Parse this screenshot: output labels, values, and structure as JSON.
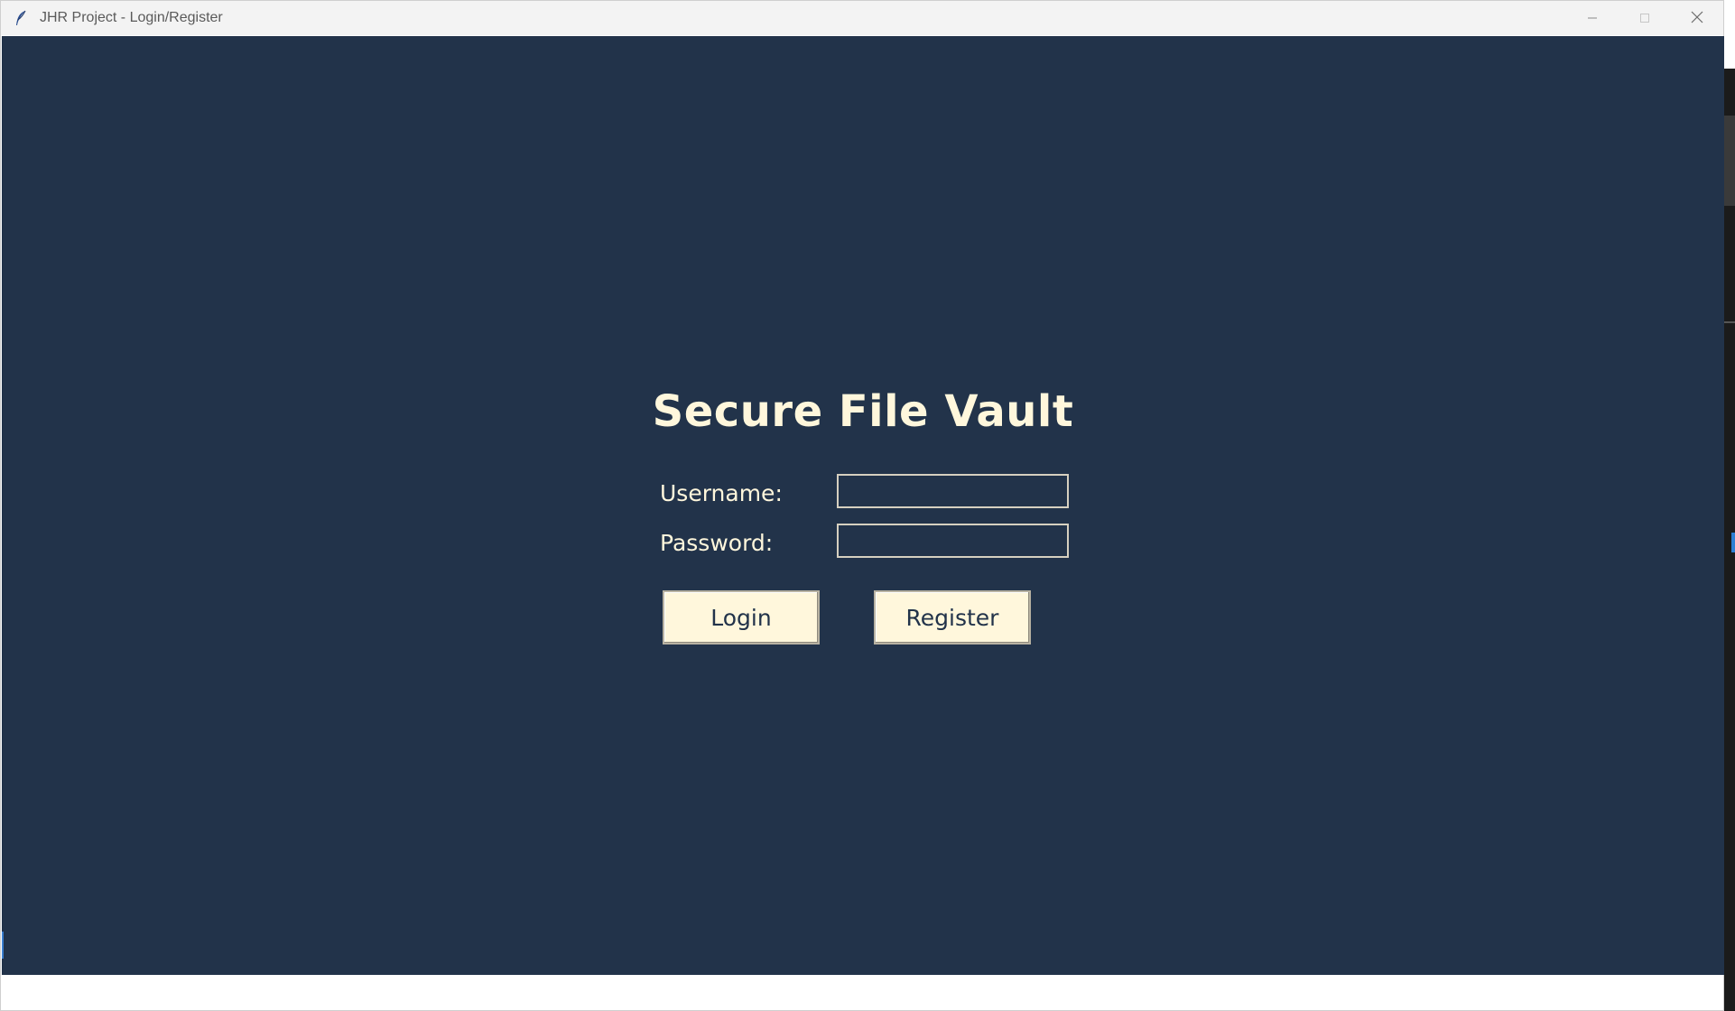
{
  "window": {
    "title": "JHR Project - Login/Register",
    "controls": [
      "minimize-icon",
      "maximize-icon",
      "close-icon"
    ]
  },
  "form": {
    "heading": "Secure File Vault",
    "username_label": "Username:",
    "username_value": "",
    "password_label": "Password:",
    "password_value": "",
    "login_label": "Login",
    "register_label": "Register"
  },
  "colors": {
    "background": "#22334a",
    "text": "#fff7dc",
    "button_bg": "#fff7dc",
    "button_text": "#22334a",
    "titlebar": "#f3f3f3"
  }
}
